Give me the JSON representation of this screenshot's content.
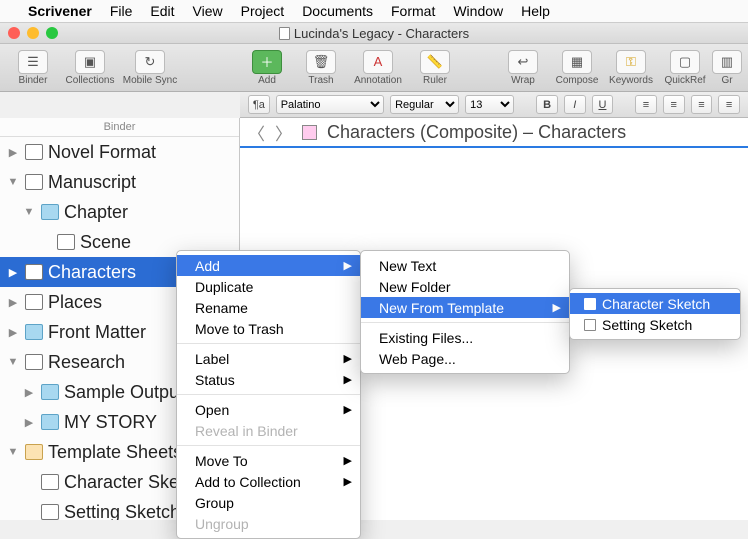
{
  "menubar": {
    "apple": "",
    "app": "Scrivener",
    "items": [
      "File",
      "Edit",
      "View",
      "Project",
      "Documents",
      "Format",
      "Window",
      "Help"
    ]
  },
  "window_title": "Lucinda's Legacy - Characters",
  "toolbar": {
    "binder": "Binder",
    "collections": "Collections",
    "mobile_sync": "Mobile Sync",
    "add": "Add",
    "trash": "Trash",
    "annotation": "Annotation",
    "ruler": "Ruler",
    "wrap": "Wrap",
    "compose": "Compose",
    "keywords": "Keywords",
    "quickref": "QuickRef",
    "groups": "Gr"
  },
  "format": {
    "para": "¶a",
    "font": "Palatino",
    "style": "Regular",
    "size": "13",
    "b": "B",
    "i": "I",
    "u": "U"
  },
  "binder": {
    "header": "Binder",
    "items": [
      {
        "label": "Novel Format",
        "lvl": 1,
        "disc": "▶",
        "ic": "doc"
      },
      {
        "label": "Manuscript",
        "lvl": 1,
        "disc": "▼",
        "ic": "doc"
      },
      {
        "label": "Chapter",
        "lvl": 2,
        "disc": "▼",
        "ic": "fold"
      },
      {
        "label": "Scene",
        "lvl": 3,
        "disc": "",
        "ic": "doc"
      },
      {
        "label": "Characters",
        "lvl": 1,
        "disc": "▶",
        "ic": "doc",
        "sel": true
      },
      {
        "label": "Places",
        "lvl": 1,
        "disc": "▶",
        "ic": "doc"
      },
      {
        "label": "Front Matter",
        "lvl": 1,
        "disc": "▶",
        "ic": "fold"
      },
      {
        "label": "Research",
        "lvl": 1,
        "disc": "▼",
        "ic": "doc"
      },
      {
        "label": "Sample Output",
        "lvl": 2,
        "disc": "▶",
        "ic": "fold"
      },
      {
        "label": "MY STORY",
        "lvl": 2,
        "disc": "▶",
        "ic": "fold"
      },
      {
        "label": "Template Sheets",
        "lvl": 1,
        "disc": "▼",
        "ic": "tpl"
      },
      {
        "label": "Character Sketch",
        "lvl": 2,
        "disc": "",
        "ic": "doc"
      },
      {
        "label": "Setting Sketch",
        "lvl": 2,
        "disc": "",
        "ic": "doc"
      }
    ]
  },
  "editor_path": "Characters (Composite) – Characters",
  "ctx1": {
    "add": "Add",
    "duplicate": "Duplicate",
    "rename": "Rename",
    "move_trash": "Move to Trash",
    "label": "Label",
    "status": "Status",
    "open": "Open",
    "reveal": "Reveal in Binder",
    "move_to": "Move To",
    "add_coll": "Add to Collection",
    "group": "Group",
    "ungroup": "Ungroup"
  },
  "ctx2": {
    "new_text": "New Text",
    "new_folder": "New Folder",
    "new_tpl": "New From Template",
    "existing": "Existing Files...",
    "web": "Web Page..."
  },
  "ctx3": {
    "char": "Character Sketch",
    "setting": "Setting Sketch"
  }
}
